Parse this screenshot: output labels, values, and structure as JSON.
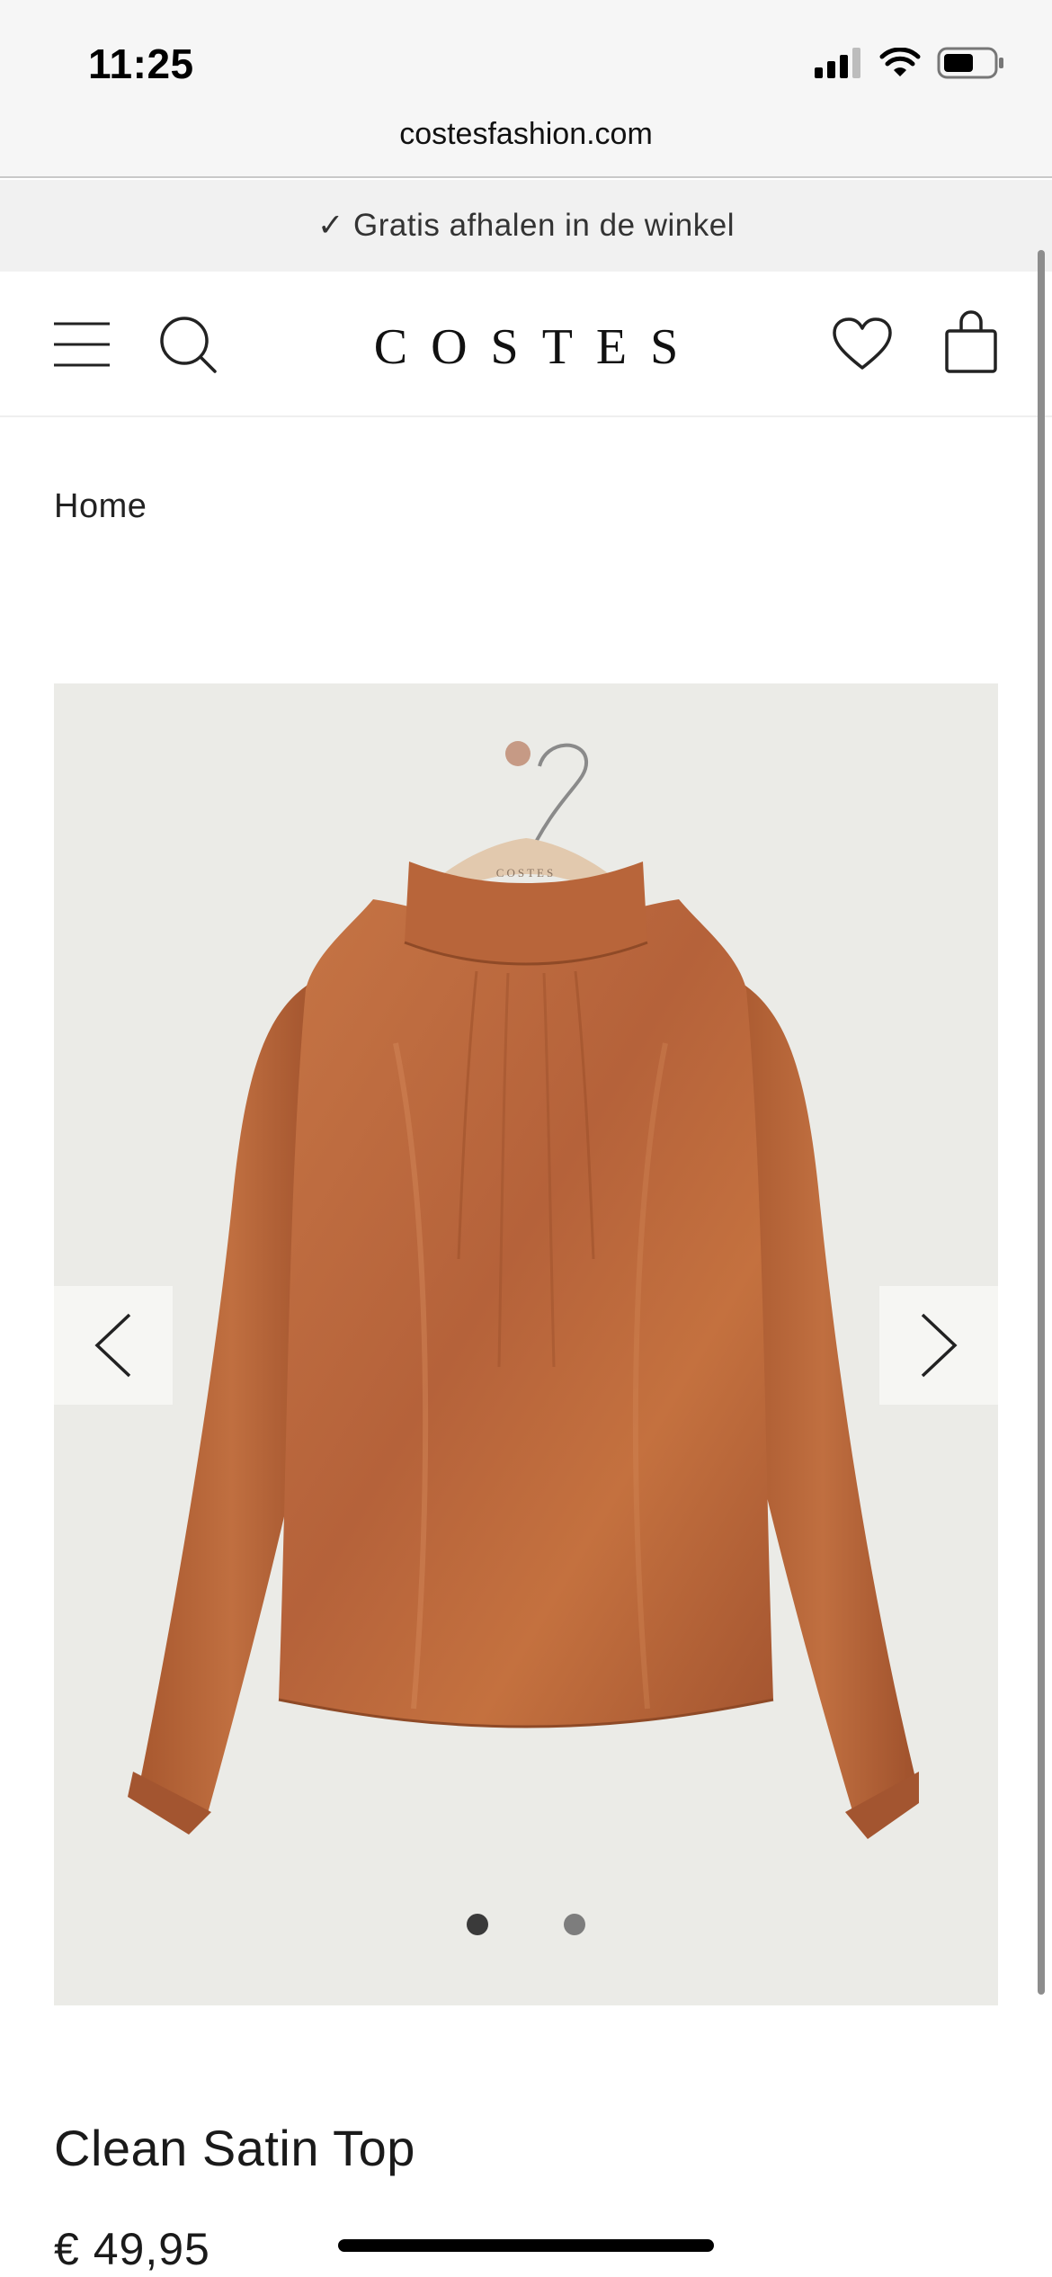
{
  "status_bar": {
    "time": "11:25",
    "icons": [
      "cellular-signal-icon",
      "wifi-icon",
      "battery-icon"
    ]
  },
  "browser": {
    "url": "costesfashion.com"
  },
  "promo": {
    "text": "✓ Gratis afhalen in de winkel"
  },
  "header": {
    "logo": "COSTES",
    "icons": [
      "menu-icon",
      "search-icon",
      "heart-icon",
      "shopping-bag-icon"
    ]
  },
  "breadcrumb": {
    "home": "Home"
  },
  "gallery": {
    "hanger_text": "COSTES",
    "image_count": 2,
    "active_index": 0,
    "colors": {
      "background": "#ebebe7",
      "garment": "#b9673a"
    }
  },
  "product": {
    "name": "Clean Satin Top",
    "price": "€ 49,95"
  }
}
